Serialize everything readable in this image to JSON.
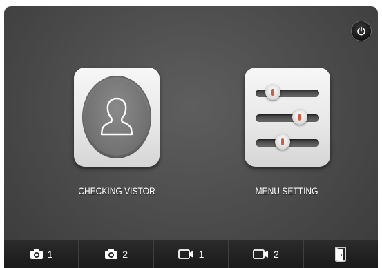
{
  "tiles": {
    "visitor_label": "CHECKING VISTOR",
    "menu_label": "MENU SETTING"
  },
  "sliders": [
    0.2,
    0.75,
    0.4
  ],
  "bottom_bar": [
    {
      "icon": "camera-icon",
      "number": "1"
    },
    {
      "icon": "camera-icon",
      "number": "2"
    },
    {
      "icon": "video-icon",
      "number": "1"
    },
    {
      "icon": "video-icon",
      "number": "2"
    },
    {
      "icon": "door-icon",
      "number": ""
    }
  ],
  "colors": {
    "background": "#4f4f4f",
    "tile": "#ebebeb",
    "slider_marker": "#d35a3c"
  }
}
